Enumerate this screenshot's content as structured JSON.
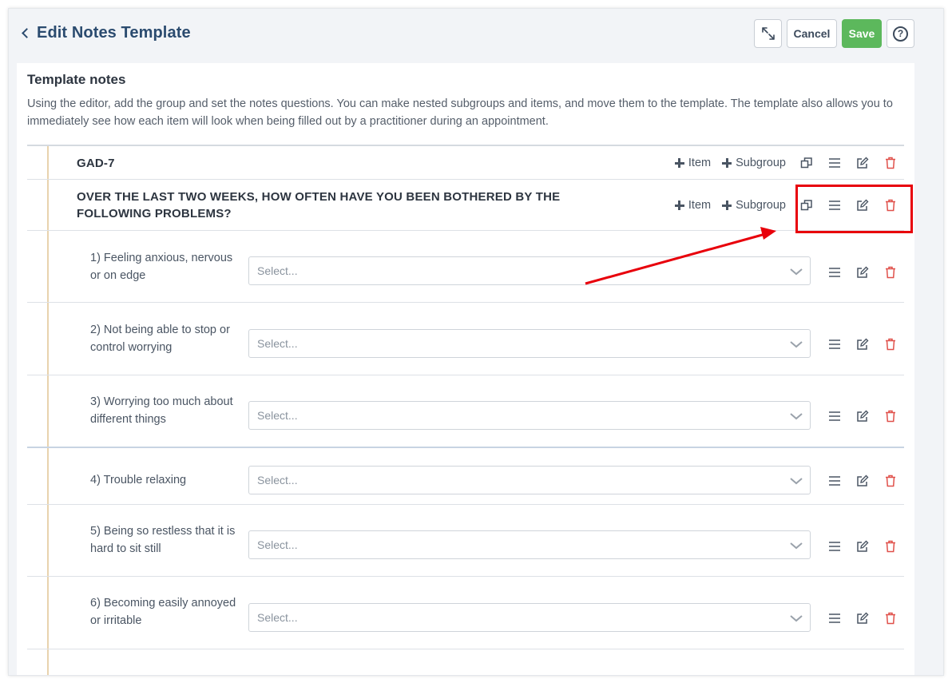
{
  "header": {
    "title": "Edit Notes Template",
    "cancel_label": "Cancel",
    "save_label": "Save",
    "help_label": "?"
  },
  "panel": {
    "title": "Template notes",
    "description": "Using the editor, add the group and set the notes questions. You can make nested subgroups and items, and move them to the template. The template also allows you to immediately see how each item will look when being filled out by a practitioner during an appointment."
  },
  "actions": {
    "add_item_label": "Item",
    "add_subgroup_label": "Subgroup"
  },
  "groups": [
    {
      "label": "GAD-7"
    },
    {
      "label": "OVER THE LAST TWO WEEKS, HOW OFTEN HAVE YOU BEEN BOTHERED BY THE FOLLOWING PROBLEMS?"
    }
  ],
  "items": [
    {
      "label": "1) Feeling anxious, nervous or on edge",
      "placeholder": "Select..."
    },
    {
      "label": "2) Not being able to stop or control worrying",
      "placeholder": "Select..."
    },
    {
      "label": "3) Worrying too much about different things",
      "placeholder": "Select..."
    },
    {
      "label": "4) Trouble relaxing",
      "placeholder": "Select..."
    },
    {
      "label": "5) Being so restless that it is hard to sit still",
      "placeholder": "Select..."
    },
    {
      "label": "6) Becoming easily annoyed or irritable",
      "placeholder": "Select..."
    }
  ],
  "colors": {
    "accent": "#2b4b6f",
    "save": "#5cb85c",
    "delete": "#e0504a",
    "annotation": "#e8000b",
    "tree_line": "#e8d3ae"
  },
  "icons": [
    "chevron-left-icon",
    "expand-icon",
    "help-icon",
    "plus-icon",
    "copy-icon",
    "drag-handle-icon",
    "edit-icon",
    "trash-icon",
    "chevron-down-icon"
  ]
}
